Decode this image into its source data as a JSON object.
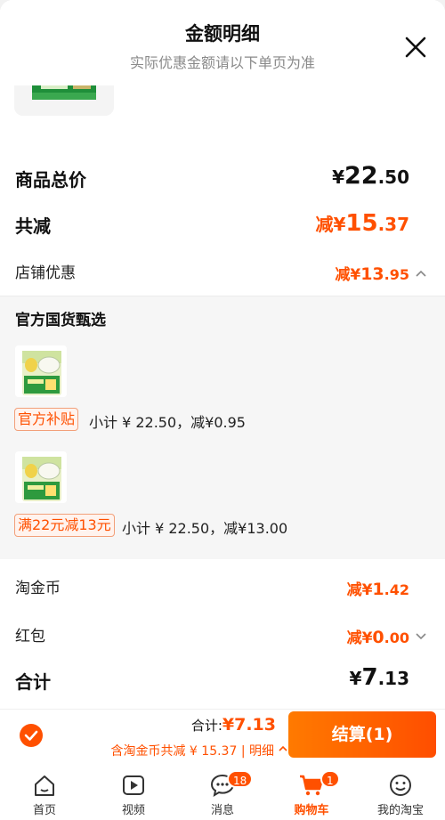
{
  "header": {
    "title": "金额明细",
    "subtitle": "实际优惠金额请以下单页为准"
  },
  "summary": {
    "goods_total": {
      "label": "商品总价",
      "symbol": "¥",
      "int": "22",
      "dec": ".50"
    },
    "total_reduce": {
      "label": "共减",
      "prefix": "减¥",
      "int": "15",
      "dec": ".37"
    },
    "shop_discount": {
      "label": "店铺优惠",
      "prefix": "减¥",
      "int": "13",
      "dec": ".95"
    }
  },
  "panel": {
    "title": "官方国货甄选",
    "items": [
      {
        "tag": "官方补贴",
        "text": "小计 ¥ 22.50，减¥0.95"
      },
      {
        "tag": "满22元减13元",
        "text": "小计 ¥ 22.50，减¥13.00"
      }
    ]
  },
  "extras": {
    "coins": {
      "label": "淘金币",
      "prefix": "减¥",
      "int": "1",
      "dec": ".42"
    },
    "redpacket": {
      "label": "红包",
      "prefix": "减¥",
      "int": "0",
      "dec": ".00"
    },
    "total": {
      "label": "合计",
      "symbol": "¥",
      "int": "7",
      "dec": ".13"
    }
  },
  "bottom": {
    "total_label": "合计:",
    "total_value": "¥7.13",
    "detail_text": "含淘金币共减 ¥ 15.37 | 明细",
    "pay_label": "结算(1)"
  },
  "tabs": [
    {
      "label": "首页",
      "icon": "home-icon"
    },
    {
      "label": "视频",
      "icon": "video-icon"
    },
    {
      "label": "消息",
      "icon": "message-icon",
      "badge": "18"
    },
    {
      "label": "购物车",
      "icon": "cart-icon",
      "badge": "1",
      "active": true
    },
    {
      "label": "我的淘宝",
      "icon": "profile-icon"
    }
  ],
  "colors": {
    "accent": "#ff5000",
    "panel_bg": "#f6f6f6"
  }
}
